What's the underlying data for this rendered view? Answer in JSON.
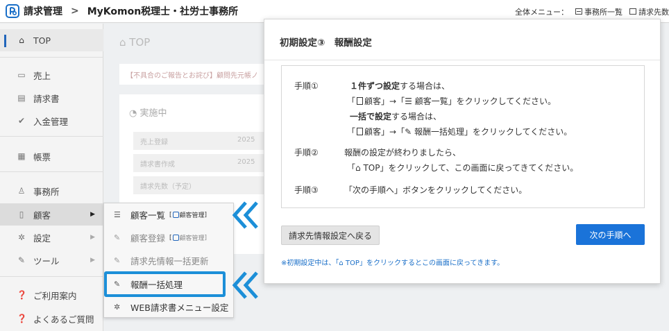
{
  "header": {
    "app_title": "請求管理",
    "separator": ">",
    "office_name": "MyKomon税理士・社労士事務所",
    "menu_label": "全体メニュー：",
    "menu_items": [
      "事務所一覧",
      "請求先数"
    ]
  },
  "sidebar": {
    "items": [
      {
        "label": "TOP",
        "icon": "home-icon"
      },
      {
        "label": "売上",
        "icon": "card-icon"
      },
      {
        "label": "請求書",
        "icon": "document-icon"
      },
      {
        "label": "入金管理",
        "icon": "check-circle-icon"
      },
      {
        "label": "帳票",
        "icon": "table-icon"
      },
      {
        "label": "事務所",
        "icon": "person-icon"
      },
      {
        "label": "顧客",
        "icon": "phone-icon"
      },
      {
        "label": "設定",
        "icon": "gear-icon"
      },
      {
        "label": "ツール",
        "icon": "wrench-icon"
      },
      {
        "label": "ご利用案内",
        "icon": "question-icon"
      },
      {
        "label": "よくあるご質問",
        "icon": "question-icon"
      }
    ]
  },
  "background": {
    "page_title": "TOP",
    "alert_text": "【不具合のご報告とお詫び】顧問先元帳ノ",
    "section_title": "実施中",
    "rows": [
      {
        "label": "売上登録",
        "value": "2025"
      },
      {
        "label": "請求書作成",
        "value": "2025"
      },
      {
        "label": "請求先数（予定）",
        "value": ""
      }
    ]
  },
  "dropdown": {
    "items": [
      {
        "label": "顧客一覧",
        "badge": "顧客管理",
        "icon": "list-icon"
      },
      {
        "label": "顧客登録",
        "badge": "顧客管理",
        "icon": "pencil-icon"
      },
      {
        "label": "請求先情報一括更新",
        "badge": "",
        "icon": "pencil-icon"
      },
      {
        "label": "報酬一括処理",
        "badge": "",
        "icon": "pencil-icon"
      },
      {
        "label": "WEB請求書メニュー設定",
        "badge": "",
        "icon": "gear-icon"
      }
    ]
  },
  "modal": {
    "title": "初期設定③　報酬設定",
    "step1_label": "手順①",
    "step1_bold": "１件ずつ設定",
    "step1_rest": "する場合は、",
    "step1_path_a1": "「",
    "step1_path_a_text1": "顧客」→「",
    "step1_path_a_text2": "顧客一覧」をクリックしてください。",
    "step1_bold2": "一括で設定",
    "step1_rest2": "する場合は、",
    "step1_path_b_text1": "顧客」→「",
    "step1_path_b_text2": "報酬一括処理」をクリックしてください。",
    "step2_label": "手順②",
    "step2_line1": "報酬の設定が終わりましたら、",
    "step2_line2_a": "「",
    "step2_line2_b": " TOP」をクリックして、この画面に戻ってきてください。",
    "step3_label": "手順③",
    "step3_text": "「次の手順へ」ボタンをクリックしてください。",
    "back_button": "請求先情報設定へ戻る",
    "next_button": "次の手順へ",
    "note_a": "※初期設定中は、「",
    "note_b": " TOP」をクリックするとこの画面に戻ってきます。"
  },
  "colors": {
    "accent": "#1a73d9",
    "highlight": "#1c8fd8",
    "note": "#1a6fc8"
  }
}
